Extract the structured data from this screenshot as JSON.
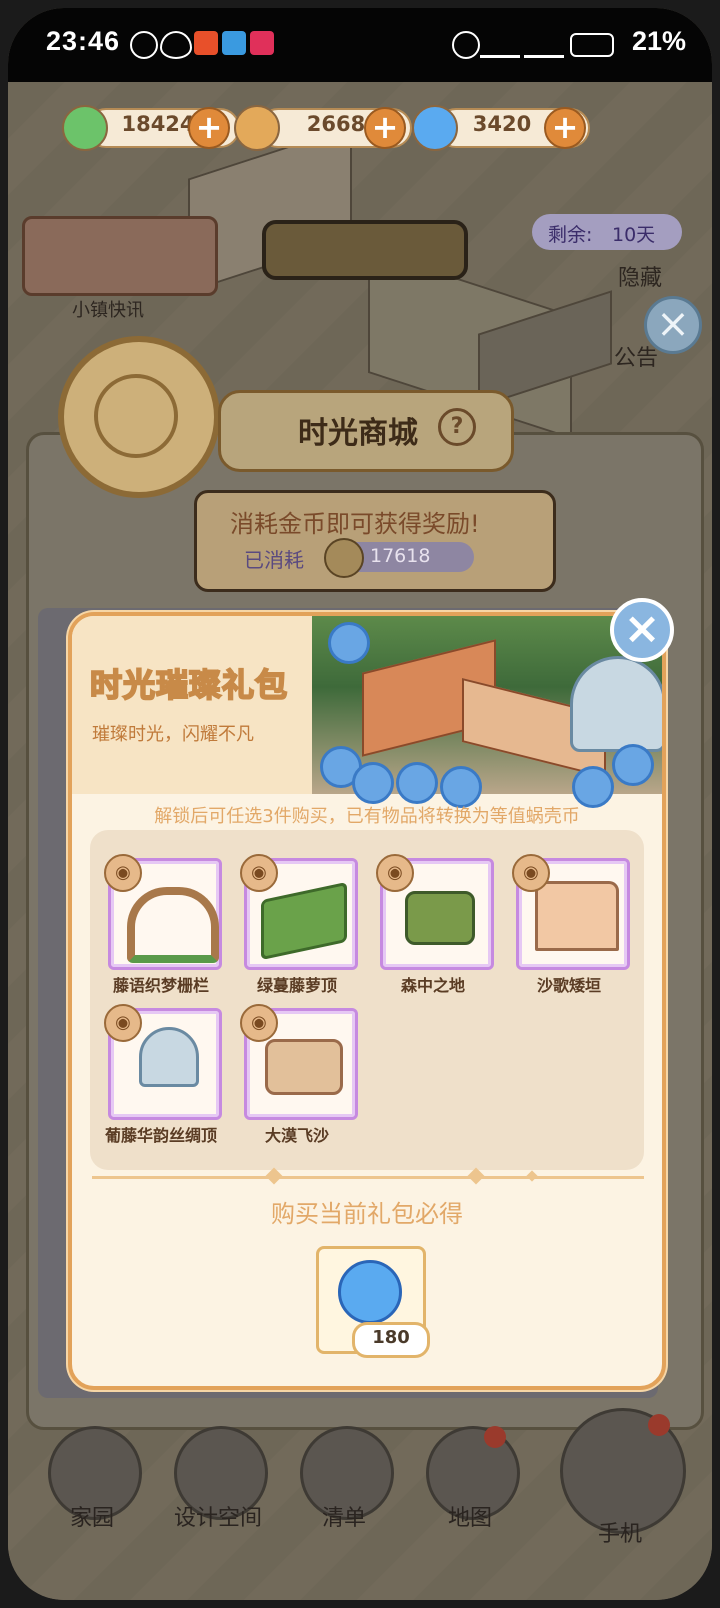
{
  "status_bar": {
    "time": "23:46",
    "battery_percent": "21%",
    "network": "4G 5G"
  },
  "currencies": [
    {
      "name": "leaf-currency",
      "value": "18424",
      "color": "#6cc36a"
    },
    {
      "name": "coin-currency",
      "value": "2668",
      "color": "#e3a95a"
    },
    {
      "name": "snail-shell-currency",
      "value": "3420",
      "color": "#5aaaf0"
    }
  ],
  "side_widgets": {
    "news_label": "小镇快讯",
    "remain_label": "剩余:",
    "remain_days": "10天",
    "hide_label": "隐藏",
    "notice_label": "公告"
  },
  "shop": {
    "title": "时光商城",
    "consume_hint": "消耗金币即可获得奖励!",
    "used_label": "已消耗",
    "used_value": "17618"
  },
  "gift_pack": {
    "title": "时光璀璨礼包",
    "subtitle": "璀璨时光，闪耀不凡",
    "hint": "解锁后可任选3件购买，已有物品将转换为等值蜗壳币",
    "items": [
      {
        "label": "藤语织梦栅栏",
        "icon": "vine-fence"
      },
      {
        "label": "绿蔓藤萝顶",
        "icon": "vine-roof"
      },
      {
        "label": "森中之地",
        "icon": "forest-floor-tile"
      },
      {
        "label": "沙歌矮垣",
        "icon": "sand-low-wall"
      },
      {
        "label": "葡藤华韵丝绸顶",
        "icon": "glass-dome-roof"
      },
      {
        "label": "大漠飞沙",
        "icon": "desert-sand-tile"
      }
    ],
    "must_get_title": "购买当前礼包必得",
    "reward": {
      "icon": "snail-shell-coin",
      "quantity": "180"
    }
  },
  "bottom_nav": [
    {
      "label": "家园"
    },
    {
      "label": "设计空间"
    },
    {
      "label": "清单"
    },
    {
      "label": "地图"
    },
    {
      "label": "手机"
    }
  ],
  "colors": {
    "modal_border": "#e2a25a",
    "item_border": "#c68ae0",
    "accent_orange": "#e2a868"
  }
}
